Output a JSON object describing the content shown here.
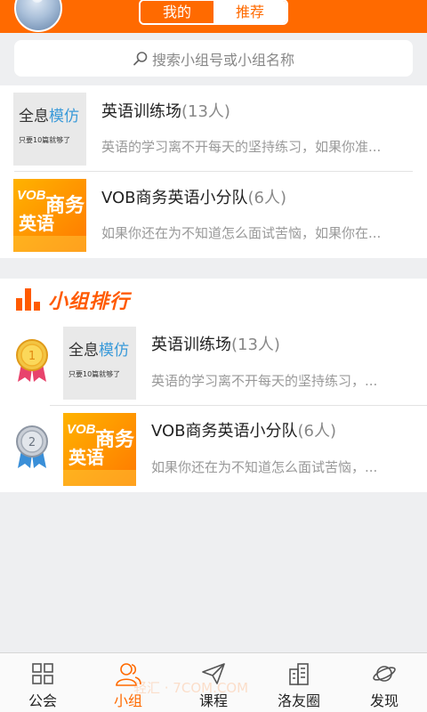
{
  "header": {
    "tab_left": "我的",
    "tab_right": "推荐",
    "accent_color": "#ff6a00"
  },
  "search": {
    "placeholder": "搜索小组号或小组名称",
    "icon": "search-icon"
  },
  "recommended_groups": [
    {
      "name": "英语训练场",
      "count": "(13人)",
      "desc": "英语的学习离不开每天的坚持练习，如果你准...",
      "thumb_text_a": "全息",
      "thumb_text_b": "模仿",
      "thumb_sub": "只要10篇就够了"
    },
    {
      "name": "VOB商务英语小分队",
      "count": "(6人)",
      "desc": "如果你还在为不知道怎么面试苦恼，如果你在...",
      "thumb_vob": "VOB",
      "thumb_sw": "商务",
      "thumb_yy": "英语"
    }
  ],
  "ranking": {
    "title": "小组排行",
    "icon": "bar-chart-icon",
    "items": [
      {
        "rank": "1",
        "name": "英语训练场",
        "count": "(13人)",
        "desc": "英语的学习离不开每天的坚持练习，...",
        "thumb_text_a": "全息",
        "thumb_text_b": "模仿",
        "thumb_sub": "只要10篇就够了",
        "medal_icon": "gold-medal-icon"
      },
      {
        "rank": "2",
        "name": "VOB商务英语小分队",
        "count": "(6人)",
        "desc": "如果你还在为不知道怎么面试苦恼，...",
        "thumb_vob": "VOB",
        "thumb_sw": "商务",
        "thumb_yy": "英语",
        "medal_icon": "silver-medal-icon"
      }
    ]
  },
  "tabbar": [
    {
      "label": "公会",
      "icon": "grid-icon",
      "active": false
    },
    {
      "label": "小组",
      "icon": "people-icon",
      "active": true
    },
    {
      "label": "课程",
      "icon": "paper-plane-icon",
      "active": false
    },
    {
      "label": "洛友圈",
      "icon": "building-icon",
      "active": false
    },
    {
      "label": "发现",
      "icon": "planet-icon",
      "active": false
    }
  ],
  "watermark": "轻汇 · 7COM.COM"
}
